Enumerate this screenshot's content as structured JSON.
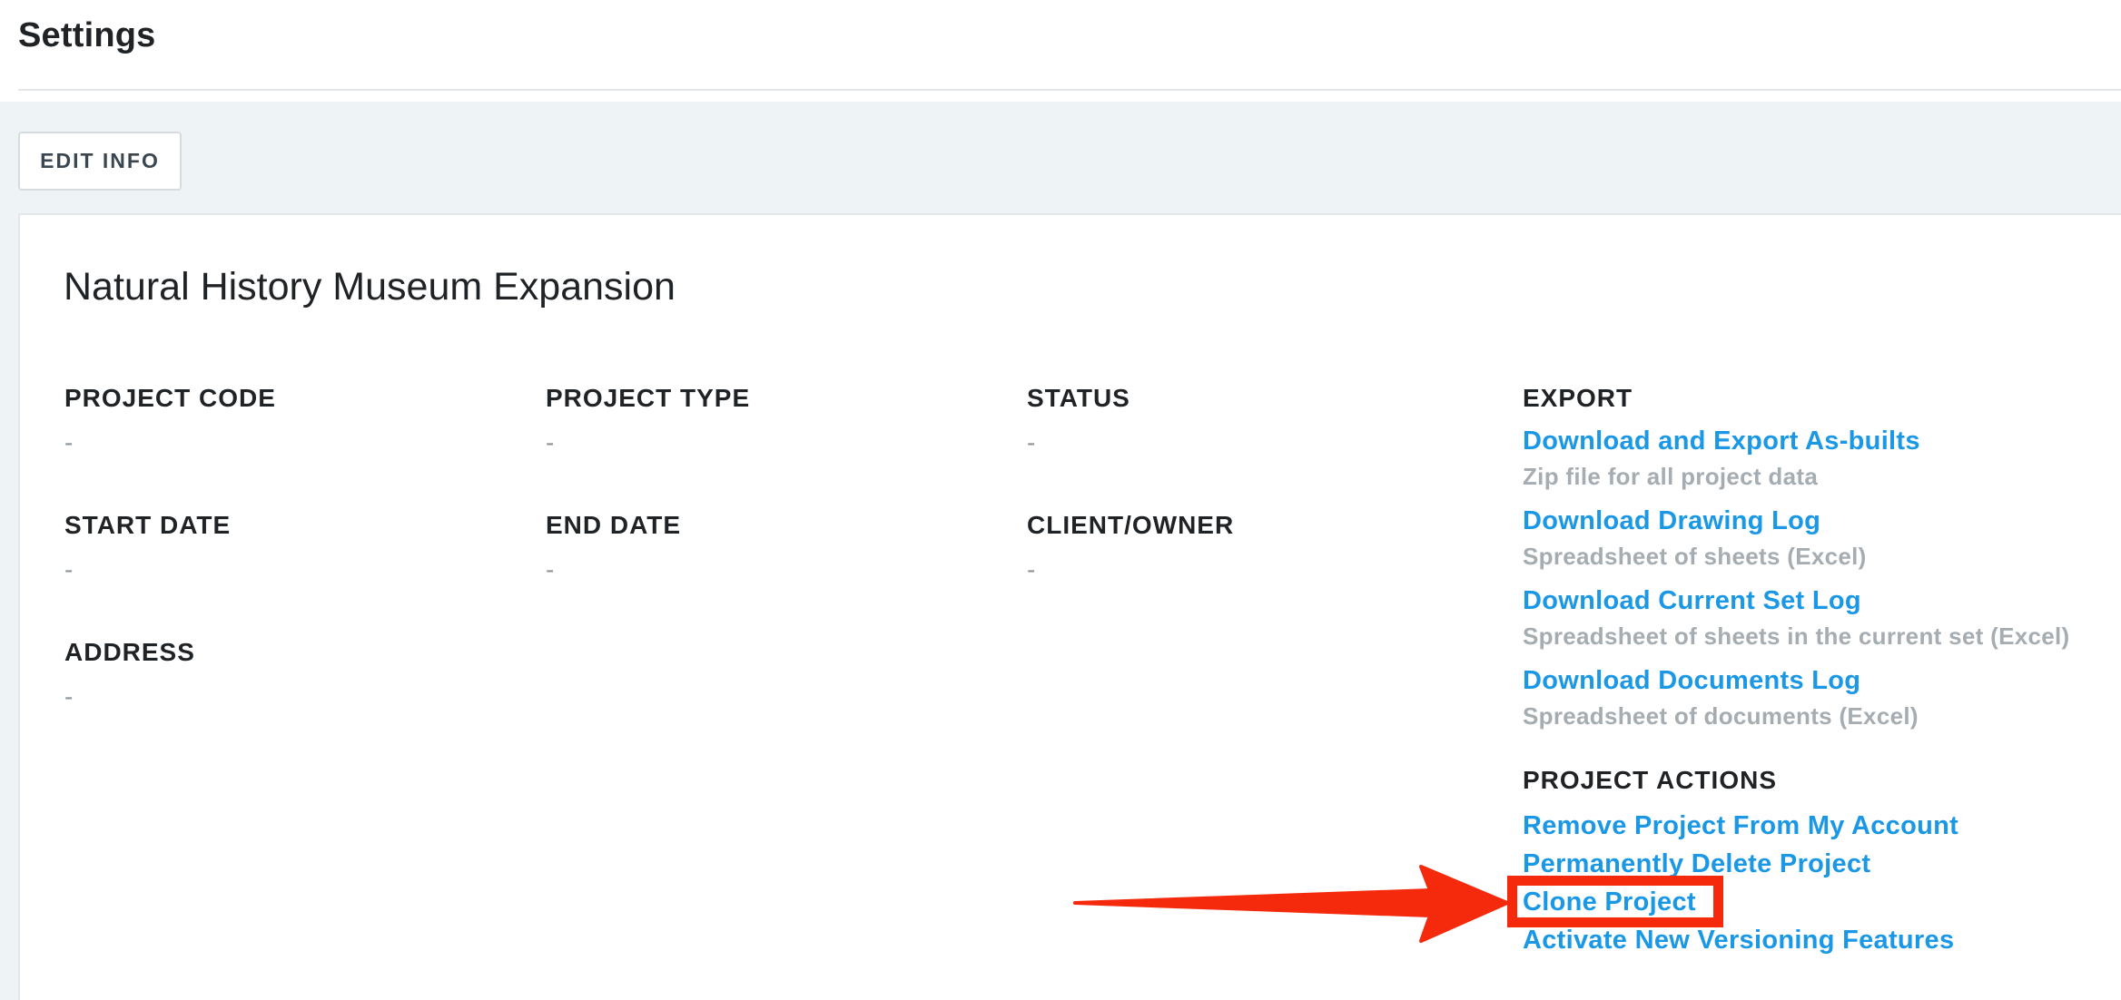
{
  "header": {
    "title": "Settings"
  },
  "toolbar": {
    "edit_info_label": "EDIT INFO"
  },
  "project": {
    "name": "Natural History Museum Expansion",
    "fields": {
      "project_code": {
        "label": "PROJECT CODE",
        "value": "-"
      },
      "project_type": {
        "label": "PROJECT TYPE",
        "value": "-"
      },
      "status": {
        "label": "STATUS",
        "value": "-"
      },
      "start_date": {
        "label": "START DATE",
        "value": "-"
      },
      "end_date": {
        "label": "END DATE",
        "value": "-"
      },
      "client_owner": {
        "label": "CLIENT/OWNER",
        "value": "-"
      },
      "address": {
        "label": "ADDRESS",
        "value": "-"
      }
    }
  },
  "export": {
    "heading": "EXPORT",
    "items": [
      {
        "label": "Download and Export As-builts",
        "description": "Zip file for all project data"
      },
      {
        "label": "Download Drawing Log",
        "description": "Spreadsheet of sheets (Excel)"
      },
      {
        "label": "Download Current Set Log",
        "description": "Spreadsheet of sheets in the current set (Excel)"
      },
      {
        "label": "Download Documents Log",
        "description": "Spreadsheet of documents (Excel)"
      }
    ]
  },
  "project_actions": {
    "heading": "PROJECT ACTIONS",
    "items": [
      {
        "label": "Remove Project From My Account"
      },
      {
        "label": "Permanently Delete Project"
      },
      {
        "label": "Clone Project"
      },
      {
        "label": "Activate New Versioning Features"
      }
    ]
  },
  "annotation": {
    "color": "#f52a0c",
    "target": "Clone Project"
  },
  "colors": {
    "link": "#1a98e6",
    "muted": "#a6adb2",
    "background": "#eef3f5",
    "text": "#1f2326"
  }
}
